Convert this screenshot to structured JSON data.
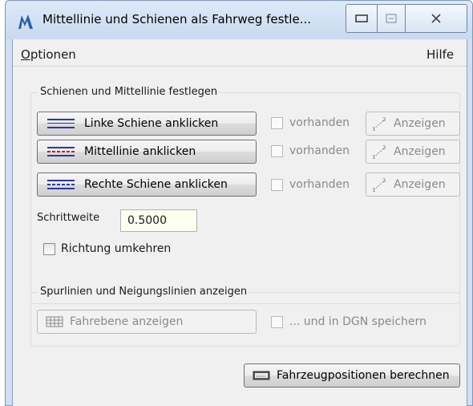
{
  "window": {
    "title": "Mittellinie und Schienen als Fahrweg festle...",
    "controls": [
      "minimize",
      "maximize",
      "close"
    ]
  },
  "menu": {
    "left_accel": "O",
    "left_rest": "ptionen",
    "right": "Hilfe"
  },
  "group1": {
    "legend": "Schienen und Mittellinie festlegen",
    "rows": [
      {
        "button": "Linke Schiene anklicken",
        "check": "vorhanden",
        "show": "Anzeigen",
        "line_color": "#2a3aa0"
      },
      {
        "button": "Mittellinie anklicken",
        "check": "vorhanden",
        "show": "Anzeigen",
        "line_color": "#d01818"
      },
      {
        "button": "Rechte Schiene anklicken",
        "check": "vorhanden",
        "show": "Anzeigen",
        "line_color": "#2a3aa0"
      }
    ],
    "step_label": "Schrittweite",
    "step_value": "0.5000",
    "reverse_label": "Richtung umkehren"
  },
  "group2": {
    "legend": "Spurlinien und Neigungslinien anzeigen",
    "plane_button": "Fahrebene anzeigen",
    "save_check": "... und in DGN speichern"
  },
  "compute_button": "Fahrzeugpositionen berechnen",
  "icons": {
    "app": "app-logo-icon",
    "line": "line-style-icon",
    "measure": "measure-icon",
    "grid": "grid-icon",
    "keyboard": "keyboard-icon"
  }
}
